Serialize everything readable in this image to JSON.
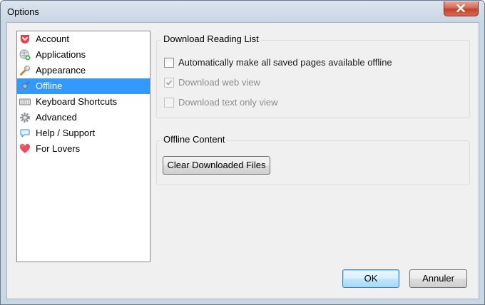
{
  "window": {
    "title": "Options"
  },
  "sidebar": {
    "items": [
      {
        "label": "Account",
        "icon": "pocket-icon",
        "selected": false
      },
      {
        "label": "Applications",
        "icon": "applications-icon",
        "selected": false
      },
      {
        "label": "Appearance",
        "icon": "wrench-icon",
        "selected": false
      },
      {
        "label": "Offline",
        "icon": "plug-icon",
        "selected": true
      },
      {
        "label": "Keyboard Shortcuts",
        "icon": "keyboard-icon",
        "selected": false
      },
      {
        "label": "Advanced",
        "icon": "gear-icon",
        "selected": false
      },
      {
        "label": "Help / Support",
        "icon": "speech-bubble-icon",
        "selected": false
      },
      {
        "label": "For Lovers",
        "icon": "heart-icon",
        "selected": false
      }
    ]
  },
  "download_reading_list": {
    "title": "Download Reading List",
    "options": [
      {
        "label": "Automatically make all saved pages available offline",
        "checked": false,
        "enabled": true
      },
      {
        "label": "Download web view",
        "checked": true,
        "enabled": false
      },
      {
        "label": "Download text only view",
        "checked": false,
        "enabled": false
      }
    ]
  },
  "offline_content": {
    "title": "Offline Content",
    "clear_button": "Clear Downloaded Files"
  },
  "footer": {
    "ok_label": "OK",
    "cancel_label": "Annuler"
  },
  "colors": {
    "selection": "#3399ff",
    "close_button": "#c7412a",
    "dialog_background": "#f0f0f0"
  }
}
